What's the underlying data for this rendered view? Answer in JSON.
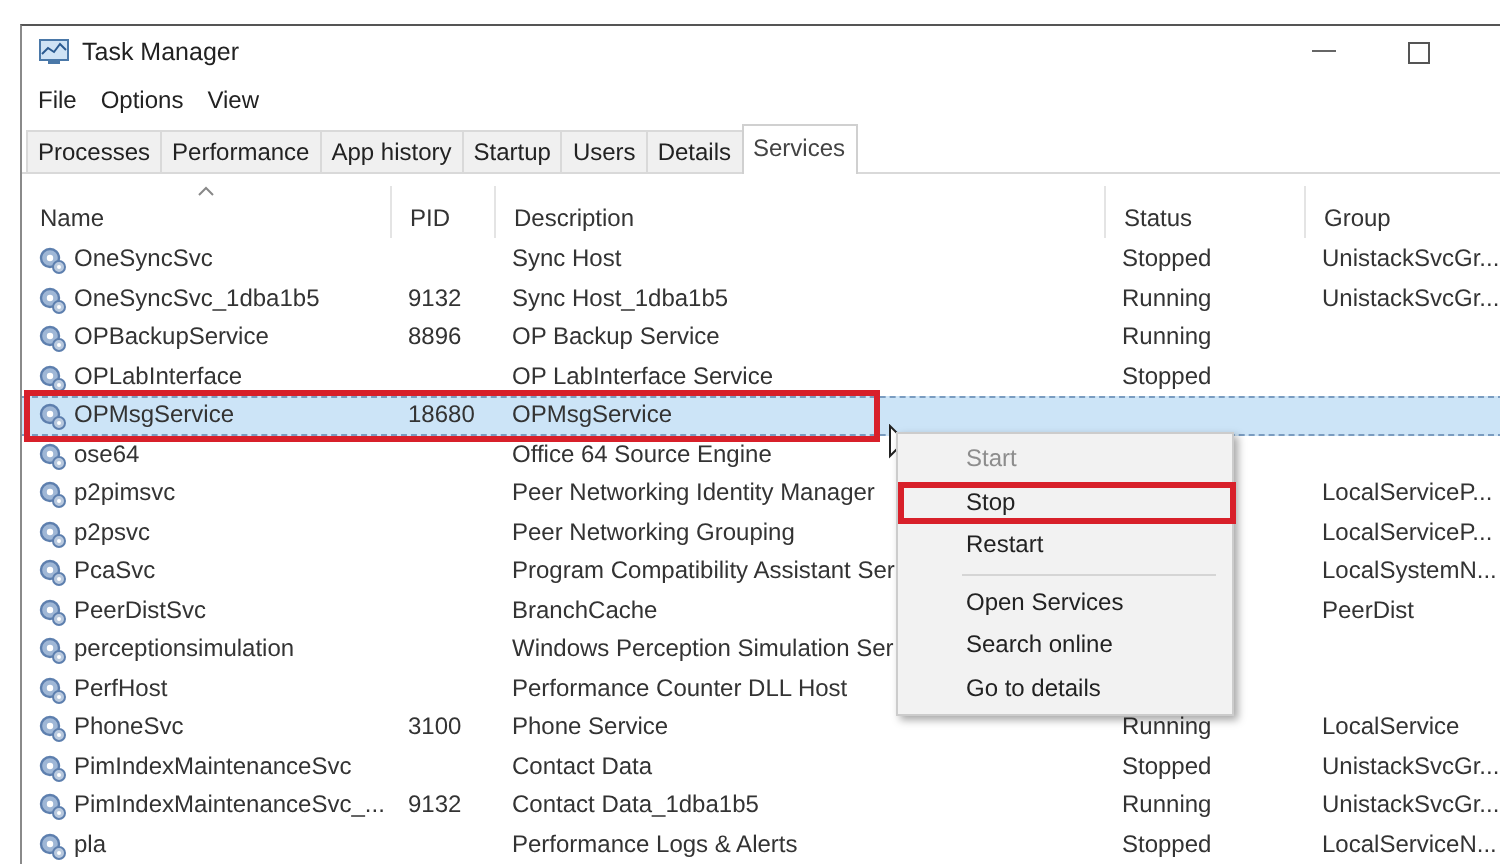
{
  "window": {
    "title": "Task Manager"
  },
  "menu_bar": [
    "File",
    "Options",
    "View"
  ],
  "tabs": [
    {
      "label": "Processes",
      "selected": false
    },
    {
      "label": "Performance",
      "selected": false
    },
    {
      "label": "App history",
      "selected": false
    },
    {
      "label": "Startup",
      "selected": false
    },
    {
      "label": "Users",
      "selected": false
    },
    {
      "label": "Details",
      "selected": false
    },
    {
      "label": "Services",
      "selected": true
    }
  ],
  "table": {
    "columns": [
      {
        "label": "Name",
        "sorted": true
      },
      {
        "label": "PID",
        "sorted": false
      },
      {
        "label": "Description",
        "sorted": false
      },
      {
        "label": "Status",
        "sorted": false
      },
      {
        "label": "Group",
        "sorted": false
      }
    ],
    "rows": [
      {
        "name": "OneSyncSvc",
        "description": "Sync Host",
        "status": "Stopped",
        "group": "UnistackSvcGr...",
        "selected": false,
        "highlighted": false
      },
      {
        "name": "OneSyncSvc_1dba1b5",
        "pid": "9132",
        "description": "Sync Host_1dba1b5",
        "status": "Running",
        "group": "UnistackSvcGr...",
        "selected": false,
        "highlighted": false
      },
      {
        "name": "OPBackupService",
        "pid": "8896",
        "description": "OP Backup Service",
        "status": "Running",
        "selected": false,
        "highlighted": false
      },
      {
        "name": "OPLabInterface",
        "description": "OP LabInterface Service",
        "status": "Stopped",
        "selected": false,
        "highlighted": false
      },
      {
        "name": "OPMsgService",
        "pid": "18680",
        "description": "OPMsgService",
        "selected": true,
        "highlighted": true
      },
      {
        "name": "ose64",
        "description": "Office 64 Source Engine",
        "selected": false,
        "highlighted": false
      },
      {
        "name": "p2pimsvc",
        "description": "Peer Networking Identity Manager",
        "group": "LocalServiceP...",
        "selected": false,
        "highlighted": false
      },
      {
        "name": "p2psvc",
        "description": "Peer Networking Grouping",
        "group": "LocalServiceP...",
        "selected": false,
        "highlighted": false
      },
      {
        "name": "PcaSvc",
        "description": "Program Compatibility Assistant Ser",
        "group": "LocalSystemN...",
        "selected": false,
        "highlighted": false
      },
      {
        "name": "PeerDistSvc",
        "description": "BranchCache",
        "group": "PeerDist",
        "selected": false,
        "highlighted": false
      },
      {
        "name": "perceptionsimulation",
        "description": "Windows Perception Simulation Ser",
        "selected": false,
        "highlighted": false
      },
      {
        "name": "PerfHost",
        "description": "Performance Counter DLL Host",
        "selected": false,
        "highlighted": false
      },
      {
        "name": "PhoneSvc",
        "pid": "3100",
        "description": "Phone Service",
        "status": "Running",
        "group": "LocalService",
        "selected": false,
        "highlighted": false
      },
      {
        "name": "PimIndexMaintenanceSvc",
        "description": "Contact Data",
        "status": "Stopped",
        "group": "UnistackSvcGr...",
        "selected": false,
        "highlighted": false
      },
      {
        "name": "PimIndexMaintenanceSvc_...",
        "pid": "9132",
        "description": "Contact Data_1dba1b5",
        "status": "Running",
        "group": "UnistackSvcGr...",
        "selected": false,
        "highlighted": false
      },
      {
        "name": "pla",
        "description": "Performance Logs & Alerts",
        "status": "Stopped",
        "group": "LocalServiceN...",
        "selected": false,
        "highlighted": false
      }
    ]
  },
  "context_menu": {
    "items": [
      {
        "kind": "item",
        "label": "Start",
        "disabled": true,
        "highlighted": false
      },
      {
        "kind": "item",
        "label": "Stop",
        "disabled": false,
        "highlighted": true
      },
      {
        "kind": "item",
        "label": "Restart",
        "disabled": false,
        "highlighted": false
      },
      {
        "kind": "separator"
      },
      {
        "kind": "item",
        "label": "Open Services",
        "disabled": false,
        "highlighted": false
      },
      {
        "kind": "item",
        "label": "Search online",
        "disabled": false,
        "highlighted": false
      },
      {
        "kind": "item",
        "label": "Go to details",
        "disabled": false,
        "highlighted": false
      }
    ]
  }
}
